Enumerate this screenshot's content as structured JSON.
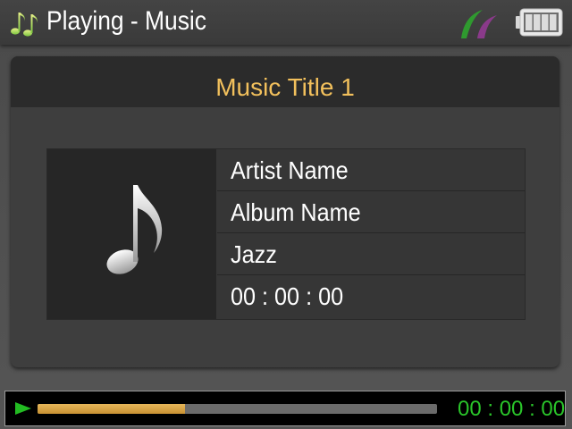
{
  "header": {
    "title": "Playing - Music",
    "app_icon": "music-notes-icon",
    "brand_icon": "brand-leaf-icon",
    "battery_icon": "battery-full-icon",
    "battery_level": 1.0
  },
  "track": {
    "title": "Music Title 1",
    "artist": "Artist Name",
    "album": "Album Name",
    "genre": "Jazz",
    "duration": "00 : 00 : 00",
    "art_icon": "music-note-icon"
  },
  "playback": {
    "state_icon": "play-icon",
    "elapsed": "00 : 00 : 00",
    "progress": 0.37
  },
  "colors": {
    "title_accent": "#f2c05c",
    "time_green": "#2ac52a",
    "progress_fill": "#e6b75a",
    "play_green": "#22bb22"
  }
}
